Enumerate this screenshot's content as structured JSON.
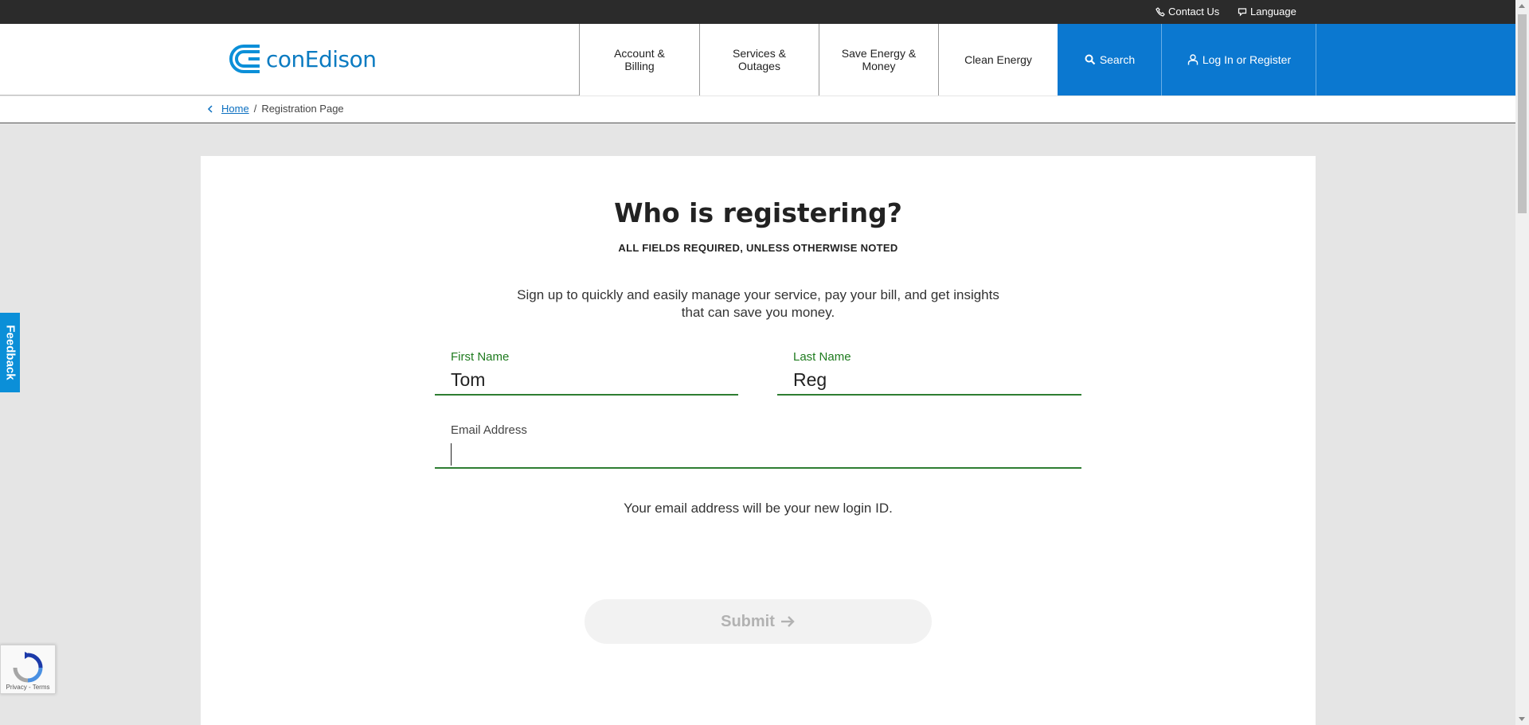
{
  "utility_bar": {
    "contact_label": "Contact Us",
    "language_label": "Language"
  },
  "header": {
    "logo_text": "conEdison",
    "nav": [
      {
        "label_line1": "Account &",
        "label_line2": "Billing"
      },
      {
        "label_line1": "Services &",
        "label_line2": "Outages"
      },
      {
        "label_line1": "Save Energy &",
        "label_line2": "Money"
      },
      {
        "label_line1": "Clean Energy",
        "label_line2": ""
      }
    ],
    "search_label": "Search",
    "login_label": "Log In or Register"
  },
  "breadcrumb": {
    "home": "Home",
    "separator": "/",
    "current": "Registration Page"
  },
  "form": {
    "title": "Who is registering?",
    "subtitle": "ALL FIELDS REQUIRED, UNLESS OTHERWISE NOTED",
    "intro": "Sign up to quickly and easily manage your service, pay your bill, and get insights that can save you money.",
    "first_name_label": "First Name",
    "first_name_value": "Tom",
    "last_name_label": "Last Name",
    "last_name_value": "Reg",
    "email_label": "Email Address",
    "email_value": "",
    "helper": "Your email address will be your new login ID.",
    "submit_label": "Submit"
  },
  "feedback_label": "Feedback",
  "recaptcha_terms": "Privacy - Terms",
  "colors": {
    "brand_blue": "#0b78d0",
    "field_green": "#2e7d32",
    "utility_bar": "#2b2b2b"
  }
}
